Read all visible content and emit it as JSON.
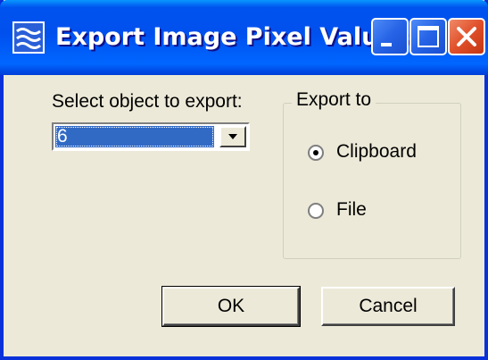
{
  "window": {
    "title": "Export Image Pixel Values",
    "title_icon": "wave-app-icon",
    "controls": [
      "minimize-icon",
      "maximize-icon",
      "close-icon"
    ]
  },
  "form": {
    "select_label": "Select object to export:",
    "selected_object": "6",
    "export_group_label": "Export to",
    "options": [
      {
        "label": "Clipboard",
        "selected": true
      },
      {
        "label": "File",
        "selected": false
      }
    ]
  },
  "buttons": {
    "ok": "OK",
    "cancel": "Cancel"
  },
  "colors": {
    "titlebar": "#0053ee",
    "close_button": "#e0502a",
    "selection": "#316ac5",
    "dialog_background": "#ece9d8"
  }
}
